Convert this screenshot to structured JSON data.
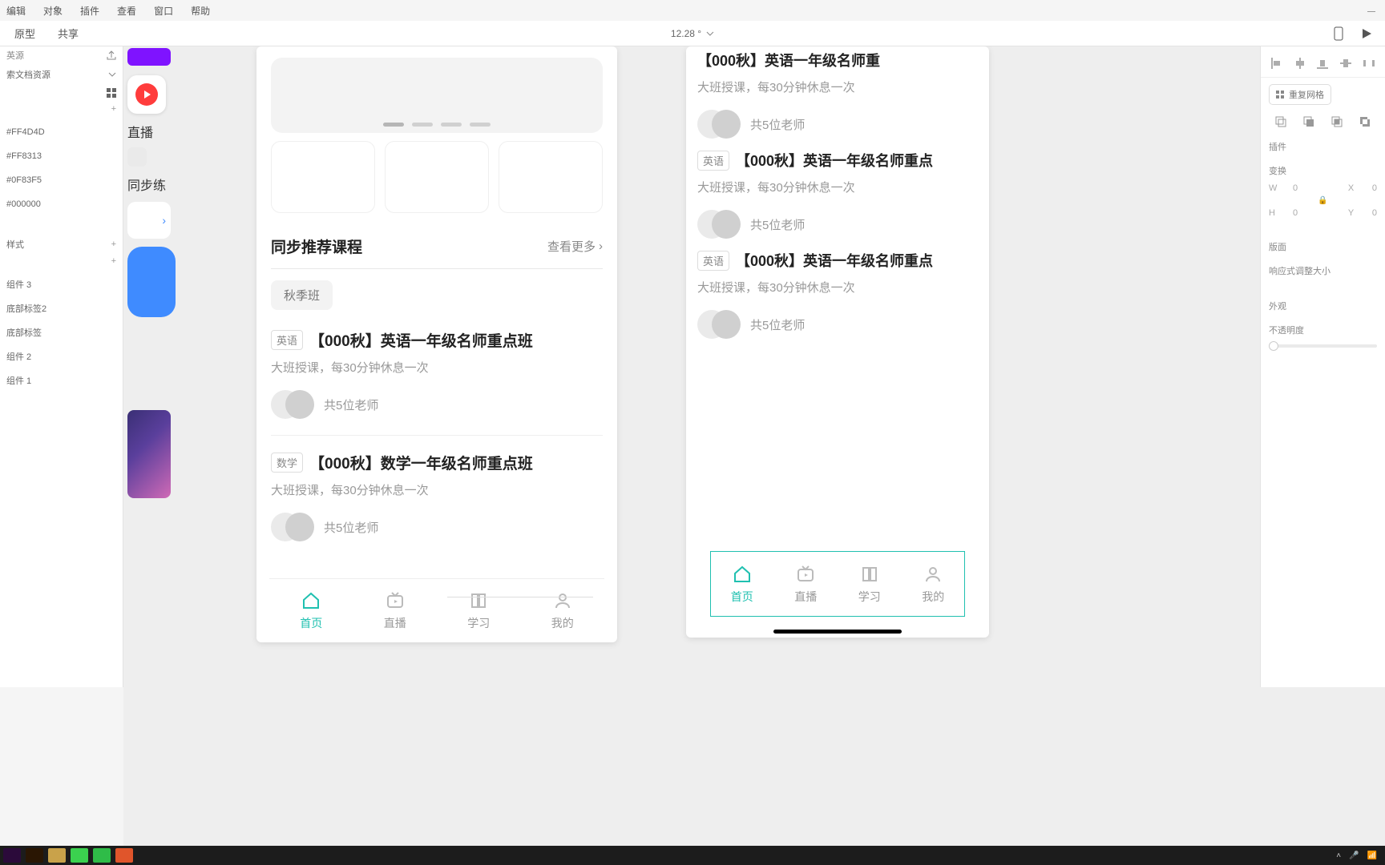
{
  "menu": {
    "items": [
      "编辑",
      "对象",
      "插件",
      "查看",
      "窗口",
      "帮助"
    ]
  },
  "tabs": {
    "left": [
      "原型",
      "共享"
    ],
    "zoom": "12.28 °"
  },
  "left": {
    "head": "英源",
    "doc": "索文档资源",
    "colors": [
      "#FF4D4D",
      "#FF8313",
      "#0F83F5",
      "#000000"
    ],
    "section_styles": "样式",
    "items": [
      "组件 3",
      "底部标签2",
      "底部标签",
      "组件 2",
      "组件 1"
    ],
    "peek_live": "直播",
    "peek_sync": "同步练"
  },
  "phoneA": {
    "section_title": "同步推荐课程",
    "more": "查看更多",
    "chip": "秋季班",
    "courses": [
      {
        "badge": "英语",
        "title": "【000秋】英语一年级名师重点班",
        "desc": "大班授课，每30分钟休息一次",
        "teachers": "共5位老师"
      },
      {
        "badge": "数学",
        "title": "【000秋】数学一年级名师重点班",
        "desc": "大班授课，每30分钟休息一次",
        "teachers": "共5位老师"
      }
    ],
    "tabs": [
      "首页",
      "直播",
      "学习",
      "我的"
    ]
  },
  "phoneB": {
    "courses": [
      {
        "badge": "",
        "title": "【000秋】英语一年级名师重",
        "desc": "大班授课，每30分钟休息一次",
        "teachers": "共5位老师"
      },
      {
        "badge": "英语",
        "title": "【000秋】英语一年级名师重点",
        "desc": "大班授课，每30分钟休息一次",
        "teachers": "共5位老师"
      },
      {
        "badge": "英语",
        "title": "【000秋】英语一年级名师重点",
        "desc": "大班授课，每30分钟休息一次",
        "teachers": "共5位老师"
      }
    ],
    "tabs": [
      "首页",
      "直播",
      "学习",
      "我的"
    ]
  },
  "right": {
    "reset_grid": "重复网格",
    "plugin": "插件",
    "transform": "变换",
    "w": "0",
    "x": "0",
    "h": "0",
    "y": "0",
    "layout": "版面",
    "responsive": "响应式调整大小",
    "appearance": "外观",
    "opacity": "不透明度"
  }
}
